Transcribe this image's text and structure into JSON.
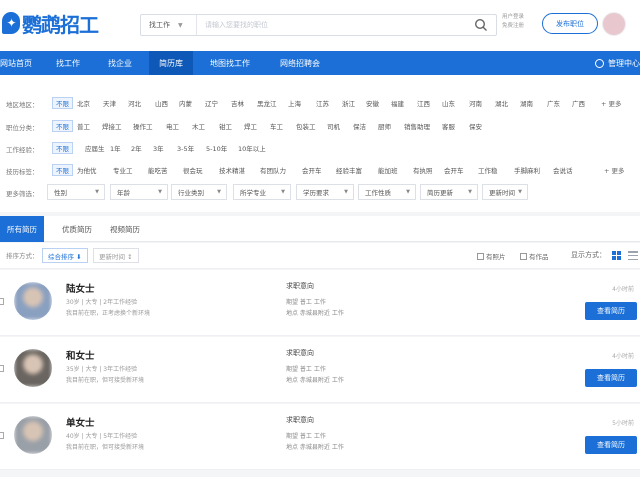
{
  "header": {
    "logo_text": "鹦鹉招工",
    "search_type": "找工作",
    "search_placeholder": "请输入您要找的职位",
    "top_links": [
      "用户登录",
      "免费注册"
    ],
    "publish_button": "发布职位"
  },
  "nav": {
    "items": [
      "网站首页",
      "找工作",
      "找企业",
      "简历库",
      "地图找工作",
      "网络招聘会"
    ],
    "active": "简历库",
    "manage_label": "管理中心"
  },
  "filters": {
    "rows": [
      {
        "label": "地区地区：",
        "options": [
          "不限",
          "北京",
          "天津",
          "河北",
          "山西",
          "内蒙",
          "辽宁",
          "吉林",
          "黑龙江",
          "上海",
          "江苏",
          "浙江",
          "安徽",
          "福建",
          "江西",
          "山东",
          "河南",
          "湖北",
          "湖南",
          "广东",
          "广西"
        ],
        "more": "+ 更多"
      },
      {
        "label": "职位分类：",
        "options": [
          "不限",
          "普工",
          "焊接工",
          "操作工",
          "电工",
          "木工",
          "钳工",
          "焊工",
          "车工",
          "包装工",
          "司机",
          "保洁",
          "厨师",
          "销售助理",
          "客服",
          "保安"
        ],
        "more": ""
      },
      {
        "label": "工作经验：",
        "options": [
          "不限",
          "应届生",
          "1年",
          "2年",
          "3年",
          "3-5年",
          "5-10年",
          "10年以上"
        ],
        "more": ""
      },
      {
        "label": "技历标签：",
        "options": [
          "不限",
          "为他优",
          "专业工",
          "能吃苦",
          "很会玩",
          "技术精湛",
          "有团队力",
          "会开车",
          "经验丰富",
          "能加班",
          "有执照",
          "会开车",
          "工作稳",
          "手脚麻利",
          "会说话"
        ],
        "more": "+ 更多"
      }
    ],
    "more_label": "更多筛选：",
    "dropdowns": [
      "性别",
      "年龄",
      "行业类别",
      "所学专业",
      "学历要求",
      "工作性质",
      "简历更新",
      "更新时间"
    ],
    "dropdown_caret": "▼"
  },
  "tabs": [
    "所有简历",
    "优质简历",
    "视频简历"
  ],
  "tabs_active": "所有简历",
  "sortbar": {
    "label": "排序方式：",
    "sorts": [
      {
        "label": "综合排序 ⬇",
        "active": true
      },
      {
        "label": "更新时间 ↕",
        "active": false
      }
    ],
    "checks": [
      "有照片",
      "有作品"
    ],
    "view_label": "显示方式："
  },
  "resumes": [
    {
      "name": "陆女士",
      "meta": "30岁 | 大专 | 2年工作经验",
      "desc": "我目前在职，正考虑换个新环境",
      "intention": "求职意向",
      "position": "期望 普工 工作",
      "location": "地点 赤城县附近 工作",
      "time": "4小时前",
      "button": "查看简历",
      "avatar_color": "#8aa0c0"
    },
    {
      "name": "和女士",
      "meta": "35岁 | 大专 | 3年工作经验",
      "desc": "我目前在职，但可接受新环境",
      "intention": "求职意向",
      "position": "期望 普工 工作",
      "location": "地点 赤城县附近 工作",
      "time": "4小时前",
      "button": "查看简历",
      "avatar_color": "#6a6560"
    },
    {
      "name": "单女士",
      "meta": "40岁 | 大专 | 5年工作经验",
      "desc": "我目前在职，但可接受新环境",
      "intention": "求职意向",
      "position": "期望 普工 工作",
      "location": "地点 赤城县附近 工作",
      "time": "5小时前",
      "button": "查看简历",
      "avatar_color": "#9aa0a8"
    }
  ]
}
